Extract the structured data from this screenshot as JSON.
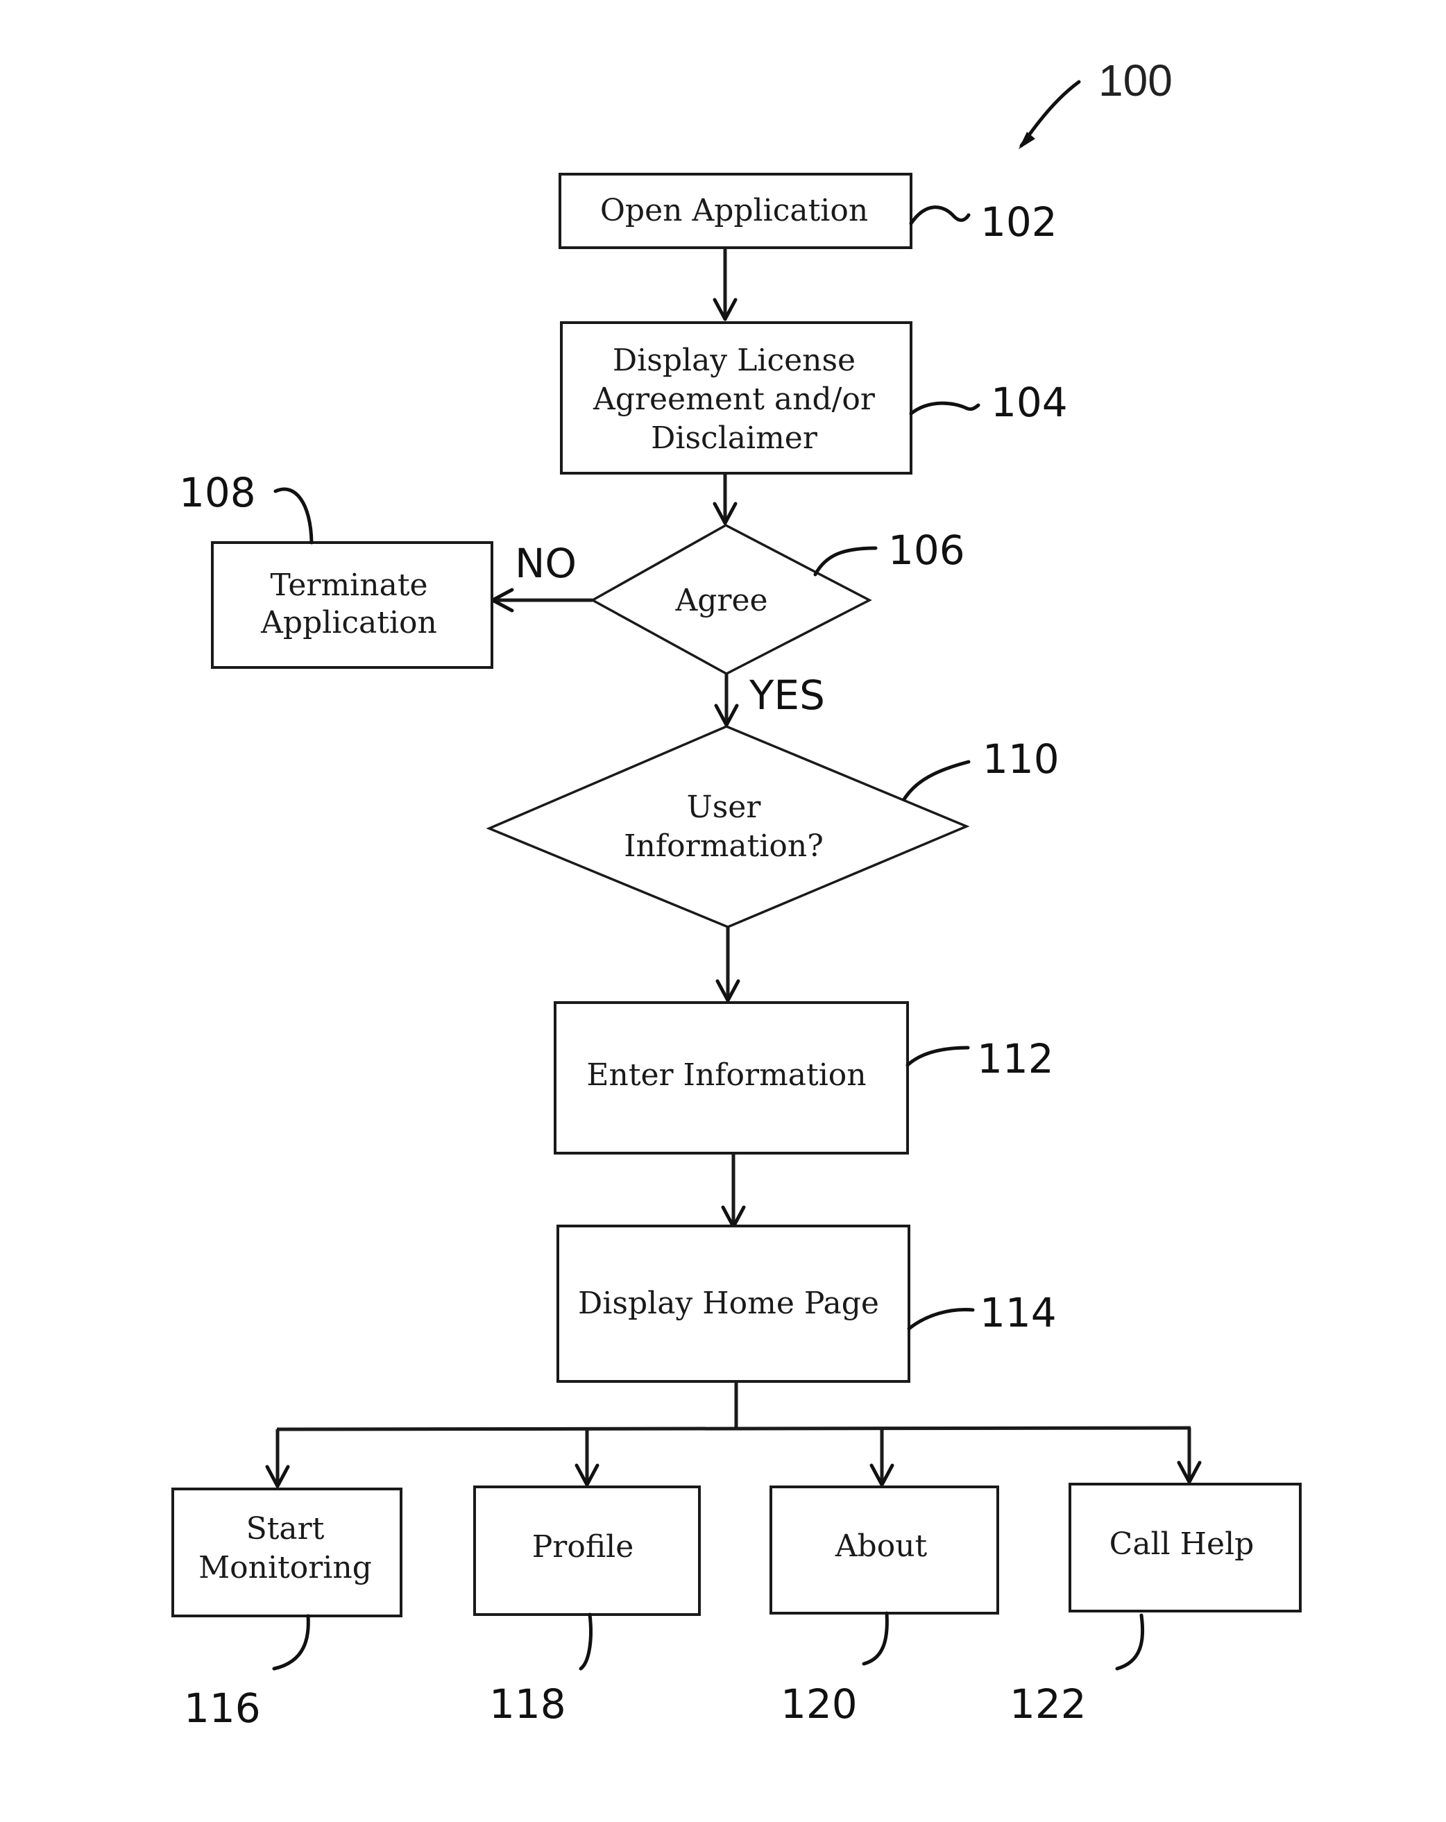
{
  "figure": {
    "reference_number": "100"
  },
  "nodes": {
    "open_application": {
      "shape": "box",
      "lines": [
        "Open Application"
      ],
      "ref": "102"
    },
    "display_license": {
      "shape": "box",
      "lines": [
        "Display License",
        "Agreement and/or",
        "Disclaimer"
      ],
      "ref": "104"
    },
    "agree": {
      "shape": "decision",
      "lines": [
        "Agree"
      ],
      "ref": "106"
    },
    "terminate_application": {
      "shape": "box",
      "lines": [
        "Terminate",
        "Application"
      ],
      "ref": "108"
    },
    "user_information": {
      "shape": "decision",
      "lines": [
        "User",
        "Information?"
      ],
      "ref": "110"
    },
    "enter_information": {
      "shape": "box",
      "lines": [
        "Enter Information"
      ],
      "ref": "112"
    },
    "display_home_page": {
      "shape": "box",
      "lines": [
        "Display Home Page"
      ],
      "ref": "114"
    },
    "start_monitoring": {
      "shape": "box",
      "lines": [
        "Start",
        "Monitoring"
      ],
      "ref": "116"
    },
    "profile": {
      "shape": "box",
      "lines": [
        "Profile"
      ],
      "ref": "118"
    },
    "about": {
      "shape": "box",
      "lines": [
        "About"
      ],
      "ref": "120"
    },
    "call_help": {
      "shape": "box",
      "lines": [
        "Call Help"
      ],
      "ref": "122"
    }
  },
  "edges": [
    {
      "from": "open_application",
      "to": "display_license",
      "label": ""
    },
    {
      "from": "display_license",
      "to": "agree",
      "label": ""
    },
    {
      "from": "agree",
      "to": "terminate_application",
      "label": "NO"
    },
    {
      "from": "agree",
      "to": "user_information",
      "label": "YES"
    },
    {
      "from": "user_information",
      "to": "enter_information",
      "label": ""
    },
    {
      "from": "enter_information",
      "to": "display_home_page",
      "label": ""
    },
    {
      "from": "display_home_page",
      "to": "start_monitoring",
      "label": ""
    },
    {
      "from": "display_home_page",
      "to": "profile",
      "label": ""
    },
    {
      "from": "display_home_page",
      "to": "about",
      "label": ""
    },
    {
      "from": "display_home_page",
      "to": "call_help",
      "label": ""
    }
  ],
  "branch_labels": {
    "no": "NO",
    "yes": "YES"
  }
}
